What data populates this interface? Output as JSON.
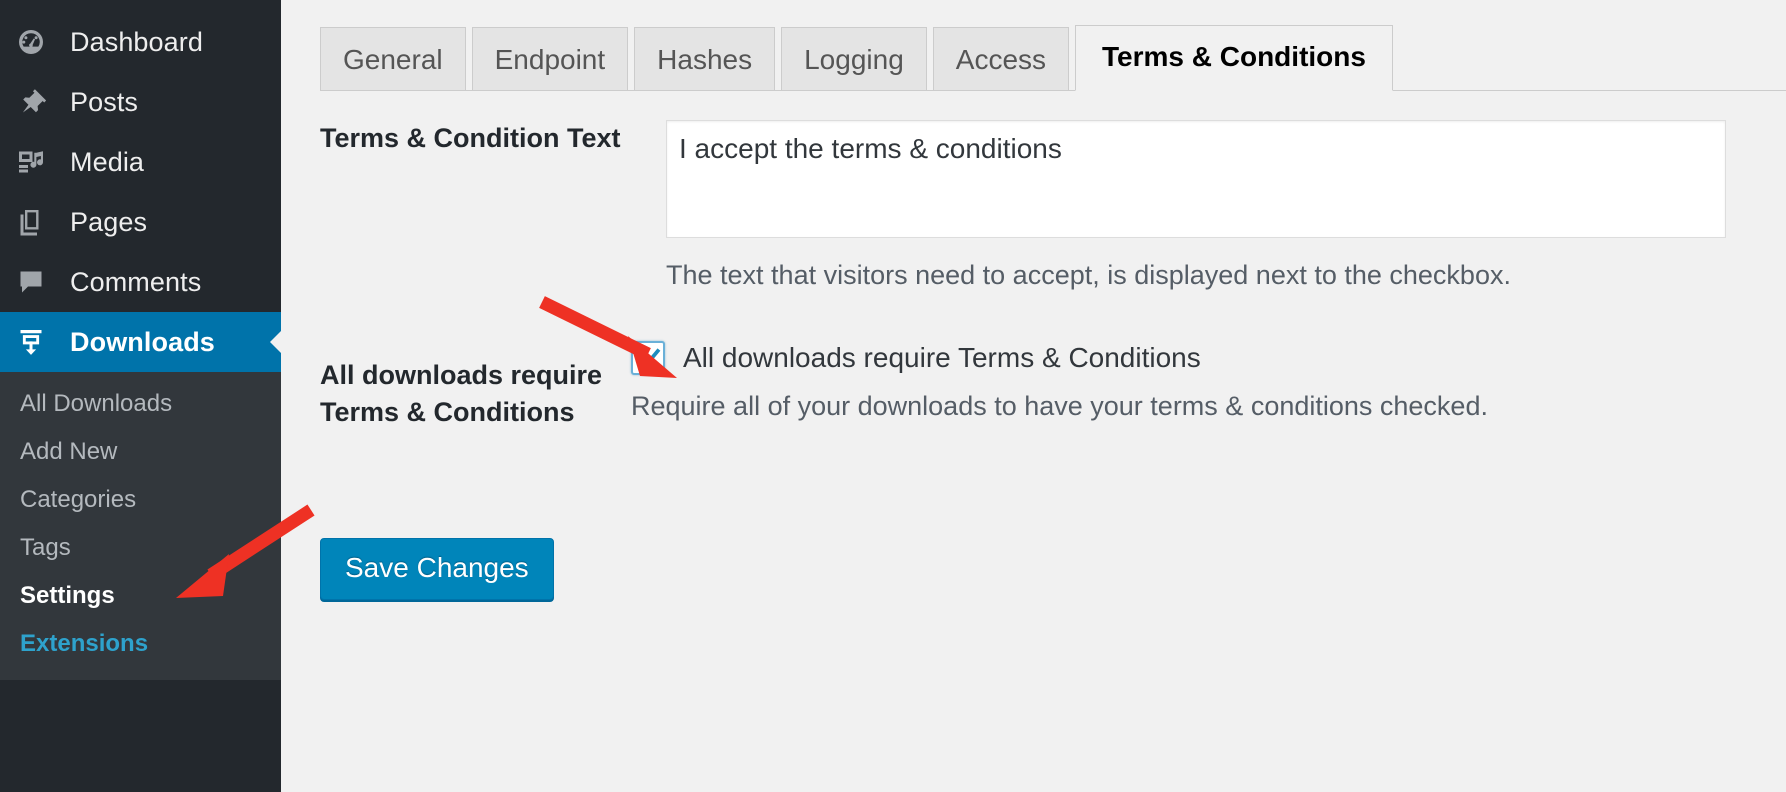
{
  "sidebar": {
    "items": [
      {
        "label": "Dashboard",
        "icon": "dashboard-icon",
        "current": false
      },
      {
        "label": "Posts",
        "icon": "pin-icon",
        "current": false
      },
      {
        "label": "Media",
        "icon": "media-icon",
        "current": false
      },
      {
        "label": "Pages",
        "icon": "pages-icon",
        "current": false
      },
      {
        "label": "Comments",
        "icon": "comments-icon",
        "current": false
      },
      {
        "label": "Downloads",
        "icon": "download-icon",
        "current": true
      }
    ],
    "submenu": [
      {
        "label": "All Downloads",
        "state": "normal"
      },
      {
        "label": "Add New",
        "state": "normal"
      },
      {
        "label": "Categories",
        "state": "normal"
      },
      {
        "label": "Tags",
        "state": "normal"
      },
      {
        "label": "Settings",
        "state": "active"
      },
      {
        "label": "Extensions",
        "state": "link"
      }
    ],
    "colors": {
      "background": "#23282d",
      "submenu_background": "#32373c",
      "current_highlight": "#0073aa",
      "link_blue": "#2ea2cc"
    }
  },
  "tabs": [
    {
      "label": "General",
      "active": false
    },
    {
      "label": "Endpoint",
      "active": false
    },
    {
      "label": "Hashes",
      "active": false
    },
    {
      "label": "Logging",
      "active": false
    },
    {
      "label": "Access",
      "active": false
    },
    {
      "label": "Terms & Conditions",
      "active": true
    }
  ],
  "form": {
    "terms_text": {
      "label": "Terms & Condition Text",
      "value": "I accept the terms & conditions",
      "description": "The text that visitors need to accept, is displayed next to the checkbox."
    },
    "require_terms": {
      "label": "All downloads require Terms & Conditions",
      "checkbox_label": "All downloads require Terms & Conditions",
      "checked": true,
      "description": "Require all of your downloads to have your terms & conditions checked."
    },
    "save_label": "Save Changes"
  },
  "annotations": {
    "arrow_color": "#ee3124",
    "arrow_to_checkbox": "arrow-pointing-to-checkbox",
    "arrow_to_settings": "arrow-pointing-to-settings"
  }
}
